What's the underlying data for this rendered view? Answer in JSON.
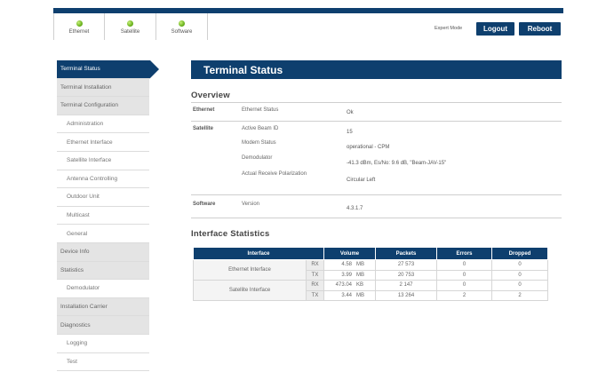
{
  "header": {
    "status_items": [
      {
        "label": "Ethernet",
        "icon": "status-led-green"
      },
      {
        "label": "Satellite",
        "icon": "status-led-green"
      },
      {
        "label": "Software",
        "icon": "status-led-green"
      }
    ],
    "expert_mode_label": "Expert Mode",
    "logout_label": "Logout",
    "reboot_label": "Reboot",
    "accent_color": "#0e3f6e",
    "status_color": "#6bb31f"
  },
  "sidebar": {
    "items": [
      {
        "label": "Terminal Status"
      },
      {
        "label": "Terminal Installation"
      },
      {
        "label": "Terminal Configuration"
      },
      {
        "label": "Administration"
      },
      {
        "label": "Ethernet Interface"
      },
      {
        "label": "Satellite Interface"
      },
      {
        "label": "Antenna Controlling"
      },
      {
        "label": "Outdoor Unit"
      },
      {
        "label": "Multicast"
      },
      {
        "label": "General"
      },
      {
        "label": "Device Info"
      },
      {
        "label": "Statistics"
      },
      {
        "label": "Demodulator"
      },
      {
        "label": "Installation Carrier"
      },
      {
        "label": "Diagnostics"
      },
      {
        "label": "Logging"
      },
      {
        "label": "Test"
      }
    ]
  },
  "main": {
    "title": "Terminal Status",
    "overview": {
      "title": "Overview",
      "ethernet": {
        "group": "Ethernet",
        "fields": [
          {
            "label": "Ethernet Status",
            "value": "Ok"
          }
        ]
      },
      "satellite": {
        "group": "Satellite",
        "fields": [
          {
            "label": "Active Beam ID",
            "value": "15"
          },
          {
            "label": "Modem Status",
            "value": "operational - CPM"
          },
          {
            "label": "Demodulator",
            "value": "-41.3 dBm, Es/No: 9.6 dB, \"Beam-JAV-15\""
          },
          {
            "label": "Actual Receive Polarization",
            "value": "Circular Left"
          }
        ]
      },
      "software": {
        "group": "Software",
        "fields": [
          {
            "label": "Version",
            "value": "4.3.1.7"
          }
        ]
      }
    },
    "interface_statistics": {
      "title": "Interface Statistics",
      "columns": [
        "Interface",
        "Volume",
        "Packets",
        "Errors",
        "Dropped"
      ],
      "rows": [
        {
          "interface": "Ethernet Interface",
          "dir": "RX",
          "volume": "4.58",
          "unit": "MB",
          "packets": "27 573",
          "errors": "0",
          "dropped": "0"
        },
        {
          "interface": "",
          "dir": "TX",
          "volume": "3.99",
          "unit": "MB",
          "packets": "20 753",
          "errors": "0",
          "dropped": "0"
        },
        {
          "interface": "Satellite Interface",
          "dir": "RX",
          "volume": "473.04",
          "unit": "KB",
          "packets": "2 147",
          "errors": "0",
          "dropped": "0"
        },
        {
          "interface": "",
          "dir": "TX",
          "volume": "3.44",
          "unit": "MB",
          "packets": "13 264",
          "errors": "2",
          "dropped": "2"
        }
      ]
    }
  }
}
